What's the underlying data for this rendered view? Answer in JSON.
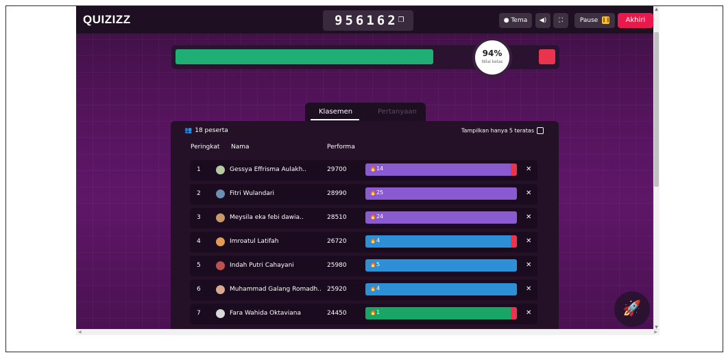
{
  "app": {
    "logo": "QUIZIZZ"
  },
  "header": {
    "game_code": "956162",
    "theme_label": "Tema",
    "pause_label": "Pause",
    "end_label": "Akhiri"
  },
  "progress": {
    "percent": "94%",
    "caption": "Nilai kelas",
    "fraction": 0.94
  },
  "tabs": [
    {
      "label": "Klasemen",
      "active": true
    },
    {
      "label": "Pertanyaan",
      "active": false
    }
  ],
  "panel": {
    "participants": "18 peserta",
    "top5_label": "Tampilkan hanya 5 teratas",
    "headers": {
      "rank": "Peringkat",
      "name": "Nama",
      "performance": "Performa"
    }
  },
  "leaderboard": [
    {
      "rank": "1",
      "name": "Gessya Effrisma Aulakh..",
      "score": "29700",
      "count": "14",
      "color": "#8a5bd0",
      "fill": 0.96,
      "wrong": 0.04,
      "avatar": "#b7c8a5"
    },
    {
      "rank": "2",
      "name": "Fitri Wulandari",
      "score": "28990",
      "count": "25",
      "color": "#8a5bd0",
      "fill": 1.0,
      "wrong": 0.0,
      "avatar": "#6b8fb3"
    },
    {
      "rank": "3",
      "name": "Meysila eka febi dawia..",
      "score": "28510",
      "count": "24",
      "color": "#8a5bd0",
      "fill": 1.0,
      "wrong": 0.0,
      "avatar": "#c89a6a"
    },
    {
      "rank": "4",
      "name": "Imroatul Latifah",
      "score": "26720",
      "count": "4",
      "color": "#2d8fd5",
      "fill": 0.96,
      "wrong": 0.04,
      "avatar": "#e39b54"
    },
    {
      "rank": "5",
      "name": "Indah Putri Cahayani",
      "score": "25980",
      "count": "5",
      "color": "#2d8fd5",
      "fill": 1.0,
      "wrong": 0.0,
      "avatar": "#c0504d"
    },
    {
      "rank": "6",
      "name": "Muhammad Galang Romadh..",
      "score": "25920",
      "count": "4",
      "color": "#2d8fd5",
      "fill": 1.0,
      "wrong": 0.0,
      "avatar": "#d9a88f"
    },
    {
      "rank": "7",
      "name": "Fara Wahida Oktaviana",
      "score": "24450",
      "count": "1",
      "color": "#19a565",
      "fill": 0.96,
      "wrong": 0.04,
      "avatar": "#d9d9d9"
    }
  ]
}
